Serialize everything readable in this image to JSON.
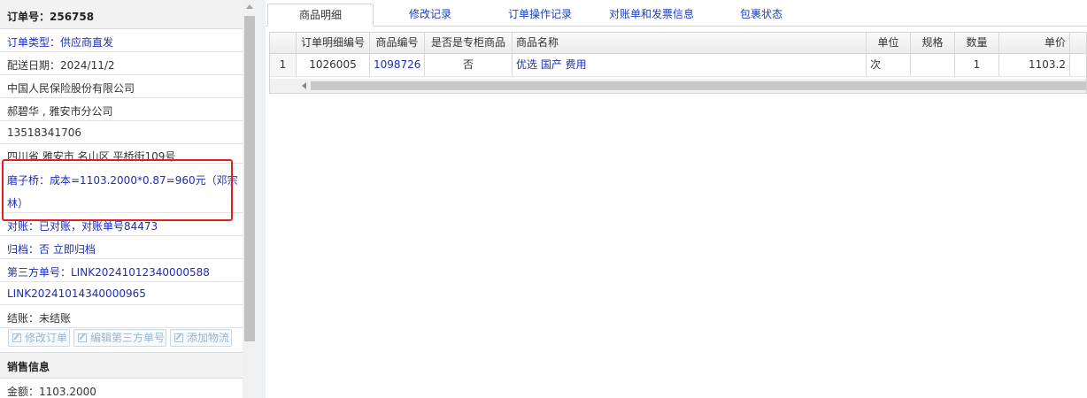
{
  "order": {
    "number_label": "订单号：256758",
    "rows": [
      {
        "text": "订单类型：供应商直发",
        "color": "blue"
      },
      {
        "text": "配送日期：2024/11/2",
        "color": "dark"
      },
      {
        "text": "中国人民保险股份有限公司",
        "color": "dark"
      },
      {
        "text": "郝碧华 , 雅安市分公司",
        "color": "dark"
      },
      {
        "text": "13518341706",
        "color": "dark"
      },
      {
        "text": "四川省 雅安市 名山区 平桥街109号",
        "color": "dark"
      }
    ],
    "cost_line1": "磨子桥：成本=1103.2000*0.87=960元（邓宗",
    "cost_line2": "林）",
    "recon": "对账：已对账，对账单号84473",
    "archive": "归档：否 立即归档",
    "third_party_label": "第三方单号：LINK20241012340000588",
    "third_party_2": "LINK20241014340000965",
    "settle": "结账：未结账",
    "buttons": {
      "edit_order": "修改订单",
      "edit_third": "编辑第三方单号",
      "add_logistics": "添加物流"
    },
    "sales_title": "销售信息",
    "amount": "金额：1103.2000"
  },
  "tabs": [
    {
      "label": "商品明细",
      "active": true
    },
    {
      "label": "修改记录",
      "active": false
    },
    {
      "label": "订单操作记录",
      "active": false
    },
    {
      "label": "对账单和发票信息",
      "active": false
    },
    {
      "label": "包裹状态",
      "active": false
    }
  ],
  "grid": {
    "headers": [
      "订单明细编号",
      "商品编号",
      "是否是专柜商品",
      "商品名称",
      "单位",
      "规格",
      "数量",
      "单价"
    ],
    "row": {
      "index": "1",
      "detail_no": "1026005",
      "product_no": "1098726",
      "counter": "否",
      "name": "优选 国产 费用",
      "unit": "次",
      "spec": "",
      "qty": "1",
      "price": "1103.2"
    }
  },
  "colors": {
    "link_blue": "#1d2db8",
    "highlight_red": "#e02020"
  }
}
